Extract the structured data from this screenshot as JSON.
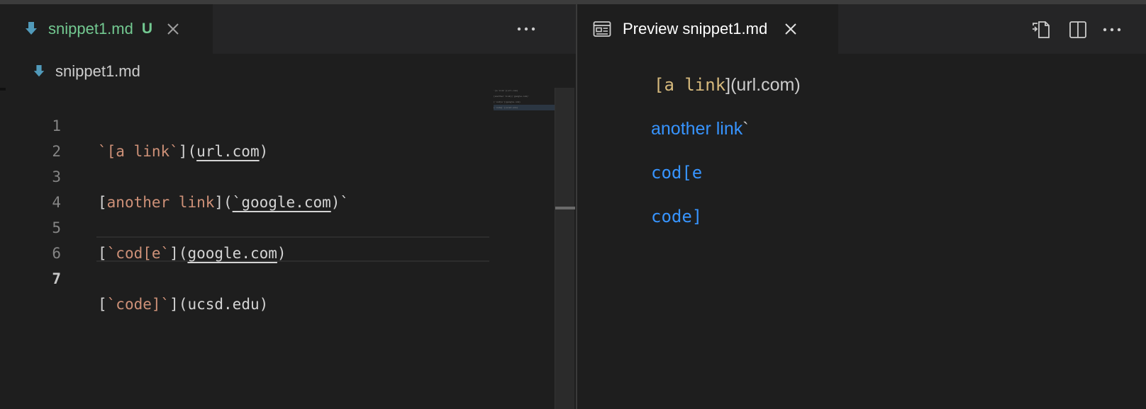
{
  "editor": {
    "tab": {
      "title": "snippet1.md",
      "badge": "U",
      "icon": "markdown-icon"
    },
    "breadcrumb": "snippet1.md",
    "lines": [
      {
        "number": "1"
      },
      {
        "number": "2"
      },
      {
        "number": "3"
      },
      {
        "number": "4"
      },
      {
        "number": "5"
      },
      {
        "number": "6"
      },
      {
        "number": "7"
      }
    ],
    "code": {
      "l1": {
        "a": "`[a link`",
        "b": "](",
        "c": "url.com",
        "d": ")"
      },
      "l3": {
        "a": "[",
        "b": "another link",
        "c": "](",
        "d": "`google.com",
        "e": ")`"
      },
      "l5": {
        "a": "[",
        "b": "`cod[e`",
        "c": "](",
        "d": "google.com",
        "e": ")"
      },
      "l7": {
        "a": "[",
        "b": "`code]`",
        "c": "](ucsd.edu)"
      }
    },
    "minimap": [
      "`[a link`](url.com)",
      "[another link](`google.com)`",
      "[`cod[e`](google.com)",
      "[`code]`](ucsd.edu)"
    ]
  },
  "preview": {
    "tab": {
      "title": "Preview snippet1.md",
      "icon": "preview-icon"
    },
    "content": {
      "p1_code": "[a link",
      "p1_text": "](url.com)",
      "p2_link": "another link",
      "p2_tick": "`",
      "p3": "cod[e",
      "p4": "code]"
    }
  },
  "colors": {
    "background": "#1e1e1e",
    "tabbar": "#252526",
    "untracked": "#73c991",
    "link": "#3794ff",
    "string": "#ce9178",
    "inline_code": "#d7ba7d"
  }
}
